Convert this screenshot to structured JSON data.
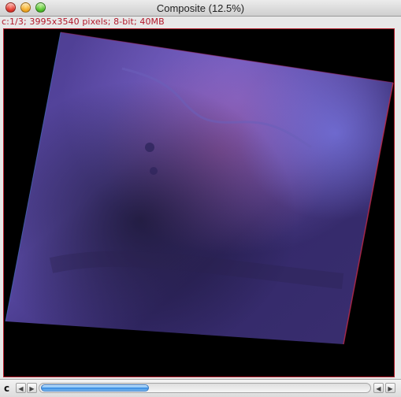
{
  "window": {
    "title": "Composite (12.5%)"
  },
  "info": {
    "text": "c:1/3; 3995x3540 pixels; 8-bit; 40MB"
  },
  "scrollbar": {
    "label": "c",
    "left_arrow": "◀",
    "right_arrow": "▶",
    "position_fraction": 0.0,
    "visible_fraction": 0.33
  },
  "icons": {
    "close": "close-icon",
    "minimize": "minimize-icon",
    "zoom": "zoom-icon"
  },
  "colors": {
    "info_text": "#b3182a",
    "canvas_border": "#b41b2a",
    "image_tint": "#4a3aa8"
  }
}
